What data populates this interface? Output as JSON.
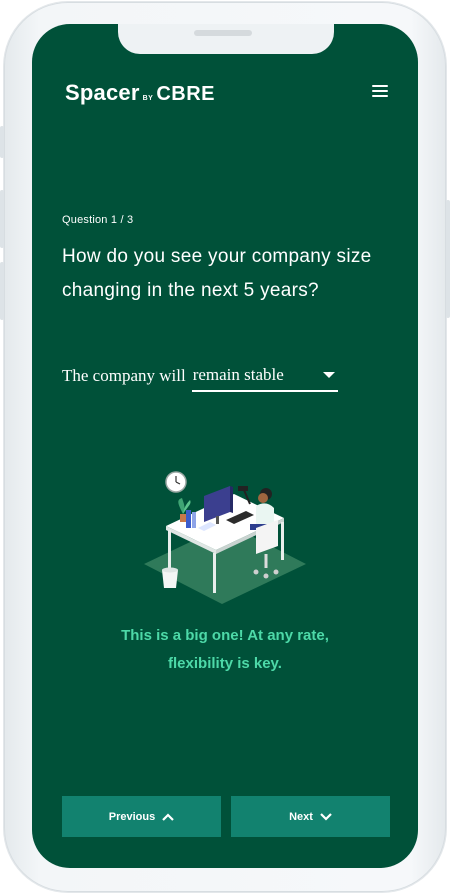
{
  "header": {
    "logo_main": "Spacer",
    "logo_by": "BY",
    "logo_brand": "CBRE",
    "menu_icon": "hamburger-menu-icon"
  },
  "question": {
    "counter": "Question 1 / 3",
    "text_line1": "How do you see your company size",
    "text_line2": "changing in the next 5 years?"
  },
  "answer": {
    "prefix": "The company will",
    "selected_value": "remain stable",
    "dropdown_icon": "caret-down-icon"
  },
  "illustration": {
    "icon": "office-desk-illustration-icon"
  },
  "feedback": {
    "line1": "This is a big one! At any rate,",
    "line2": "flexibility is key."
  },
  "navigation": {
    "previous_label": "Previous",
    "next_label": "Next"
  },
  "colors": {
    "background": "#005139",
    "button": "#12826f",
    "accent": "#4dd9a8",
    "text": "#ffffff"
  }
}
